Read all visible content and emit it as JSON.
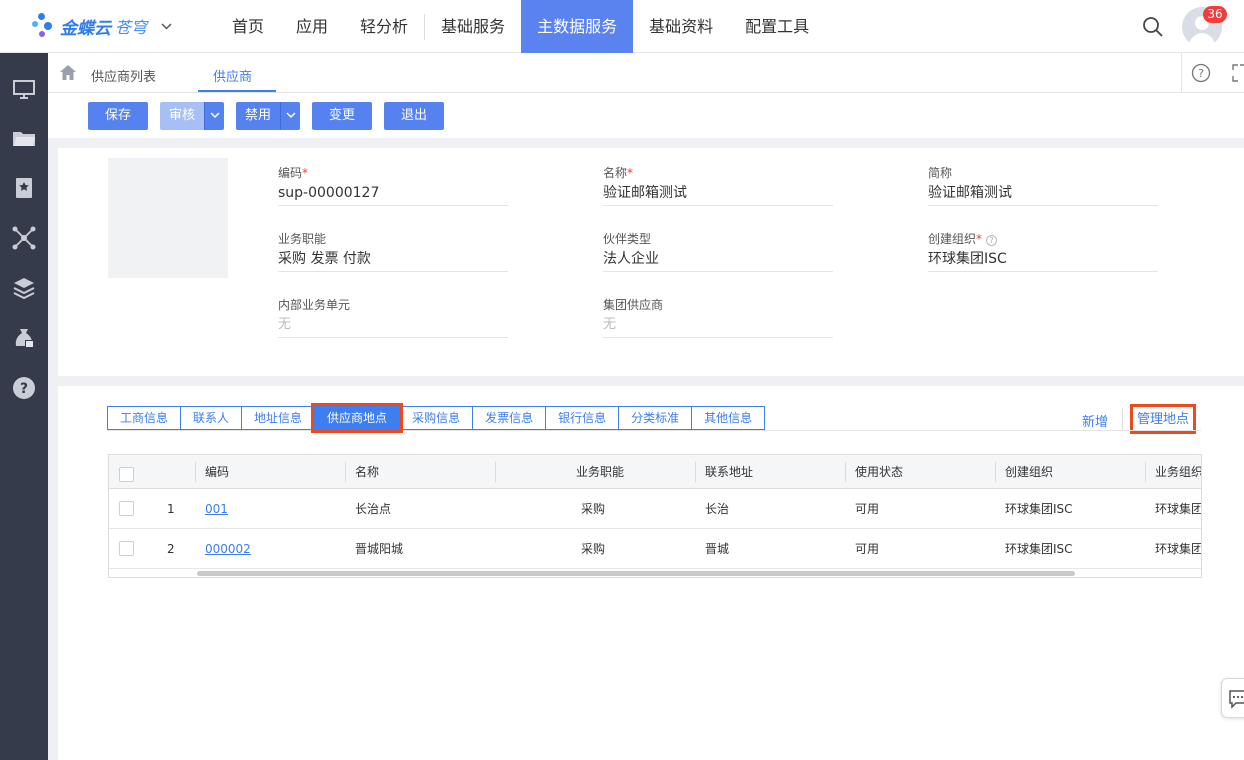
{
  "app": {
    "brand": "金蝶云",
    "brand_sub": "苍穹",
    "notification_count": "36"
  },
  "nav": {
    "items": [
      "首页",
      "应用",
      "轻分析",
      "基础服务",
      "主数据服务",
      "基础资料",
      "配置工具"
    ],
    "active": "主数据服务"
  },
  "tabs": {
    "list": "供应商列表",
    "current": "供应商"
  },
  "toolbar": {
    "save": "保存",
    "audit": "审核",
    "disable": "禁用",
    "change": "变更",
    "exit": "退出"
  },
  "form": {
    "code_label": "编码",
    "code_value": "sup-00000127",
    "name_label": "名称",
    "name_value": "验证邮箱测试",
    "short_label": "简称",
    "short_value": "验证邮箱测试",
    "func_label": "业务职能",
    "func_value": "采购 发票 付款",
    "partner_label": "伙伴类型",
    "partner_value": "法人企业",
    "org_label": "创建组织",
    "org_value": "环球集团ISC",
    "internal_label": "内部业务单元",
    "internal_value": "无",
    "group_label": "集团供应商",
    "group_value": "无",
    "required_mark": "*"
  },
  "subtabs": [
    "工商信息",
    "联系人",
    "地址信息",
    "供应商地点",
    "采购信息",
    "发票信息",
    "银行信息",
    "分类标准",
    "其他信息"
  ],
  "subtab_active": "供应商地点",
  "actions": {
    "new": "新增",
    "manage": "管理地点"
  },
  "table": {
    "columns": [
      "编码",
      "名称",
      "业务职能",
      "联系地址",
      "使用状态",
      "创建组织",
      "业务组织"
    ],
    "rows": [
      {
        "idx": "1",
        "code": "001",
        "name": "长治点",
        "func": "采购",
        "addr": "长治",
        "status": "可用",
        "org": "环球集团ISC",
        "biz_org": "环球集团"
      },
      {
        "idx": "2",
        "code": "000002",
        "name": "晋城阳城",
        "func": "采购",
        "addr": "晋城",
        "status": "可用",
        "org": "环球集团ISC",
        "biz_org": "环球集团"
      }
    ]
  },
  "colors": {
    "accent": "#3d7ef0",
    "nav_active": "#5b83f0",
    "highlight": "#ea4a1e",
    "rail": "#353b4b"
  }
}
